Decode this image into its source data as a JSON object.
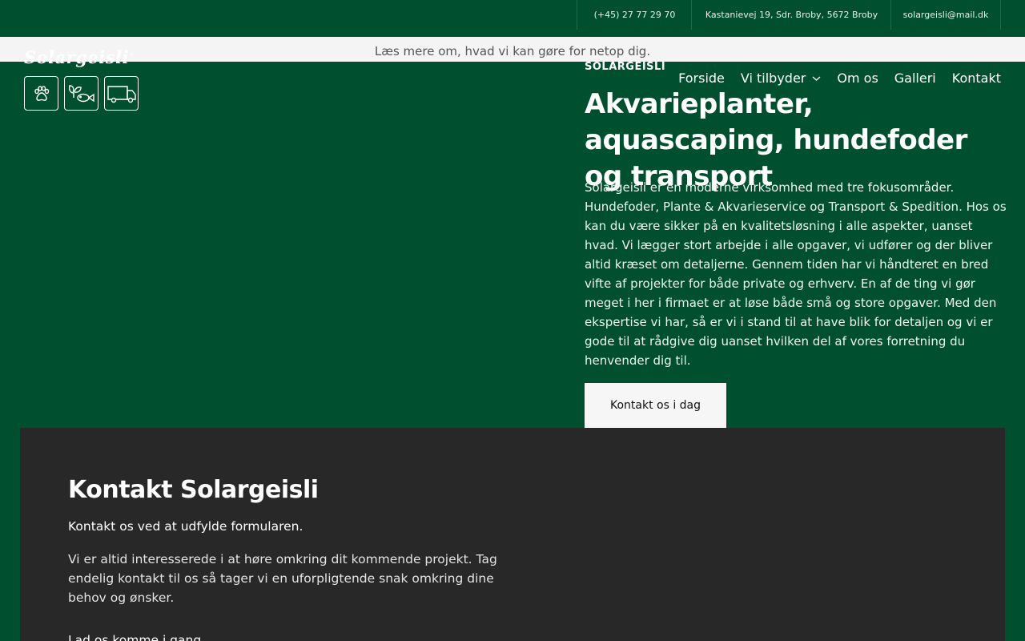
{
  "topbar": {
    "phone": "(+45) 27 77 29 70",
    "address": "Kastanievej 19, Sdr. Broby, 5672 Broby",
    "email": "solargeisli@mail.dk"
  },
  "notice": "Læs mere om, hvad vi kan gøre for netop dig.",
  "logo": {
    "text": "Solargeisli",
    "mark": "®"
  },
  "service_icons": [
    "paw-icon",
    "plant-fish-icon",
    "van-icon"
  ],
  "nav": {
    "items": [
      {
        "label": "Forside"
      },
      {
        "label": "Vi tilbyder",
        "has_dropdown": true
      },
      {
        "label": "Om os"
      },
      {
        "label": "Galleri"
      },
      {
        "label": "Kontakt"
      }
    ]
  },
  "hero": {
    "eyebrow": "SOLARGEISLI",
    "title": "Akvarieplanter, aquascaping, hundefoder og transport",
    "text": "Solargeisli er en moderne virksomhed med tre fokusområder. Hundefoder, Plante & Akvarieservice og Transport & Spedition. Hos os kan du være sikker på en kvalitetsløsning i alle aspekter, uanset hvad. Vi lægger stort arbejde i alle opgaver, vi udfører og der bliver altid kræset om detaljerne. Gennem tiden har vi håndteret en bred vifte af projekter for både private og erhverv. En af de ting vi gør meget i her i firmaet er at løse både små og store opgaver. Med den ekspertise vi har, så er vi i stand til at have blik for detaljen og vi er gode til at rådgive dig uanset hvilken del af vores forretning du henvender dig til.",
    "cta_label": "Kontakt os i dag"
  },
  "contact": {
    "title": "Kontakt Solargeisli",
    "lead": "Kontakt os ved at udfylde formularen.",
    "body": "Vi er altid interesserede i at høre omkring dit kommende projekt. Tag endelig kontakt til os så tager vi en uforpligtende snak omkring dine behov og ønsker.",
    "next_heading": "Lad os komme i gang"
  },
  "colors": {
    "brand_green": "#00502f",
    "dark_panel": "#282828",
    "notice_bg": "#f3f4f3"
  }
}
